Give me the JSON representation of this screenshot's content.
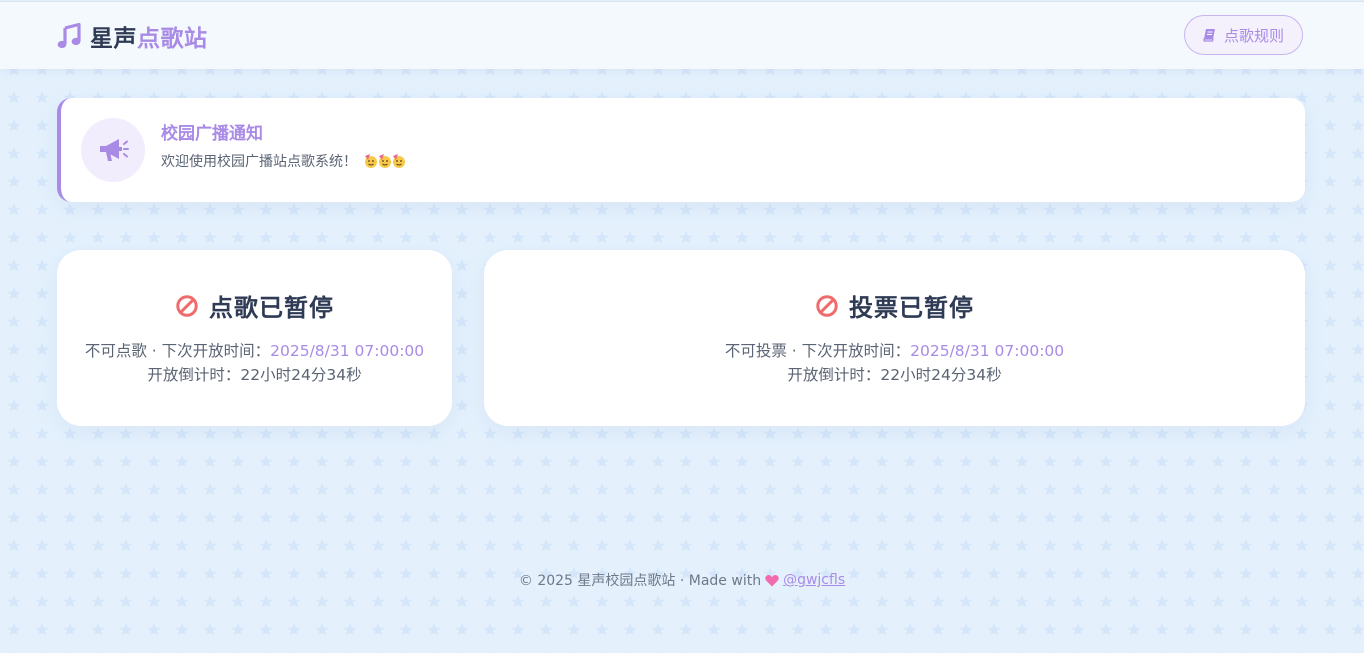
{
  "header": {
    "brand_main": "星声",
    "brand_accent": "点歌站",
    "rules_button_label": "点歌规则"
  },
  "notice": {
    "title": "校园广播通知",
    "text": "欢迎使用校园广播站点歌系统！"
  },
  "song_status": {
    "title": "点歌已暂停",
    "status_prefix": "不可点歌 · 下次开放时间：",
    "next_open": "2025/8/31 07:00:00",
    "countdown_label": "开放倒计时：",
    "countdown": "22小时24分34秒"
  },
  "vote_status": {
    "title": "投票已暂停",
    "status_prefix": "不可投票 · 下次开放时间：",
    "next_open": "2025/8/31 07:00:00",
    "countdown_label": "开放倒计时：",
    "countdown": "22小时24分34秒"
  },
  "footer": {
    "copyright": "© 2025 星声校园点歌站 · Made with",
    "author": "@gwjcfls"
  },
  "icons": {
    "brand": "music-note-icon",
    "rules": "book-icon",
    "notice": "megaphone-icon",
    "status": "ban-icon",
    "footer": "heart-icon",
    "emoji": "party-face-icon"
  },
  "colors": {
    "accent": "#a98be6",
    "ban": "#f06b6b",
    "heart": "#f26bb0",
    "background": "#e4f1fd"
  }
}
